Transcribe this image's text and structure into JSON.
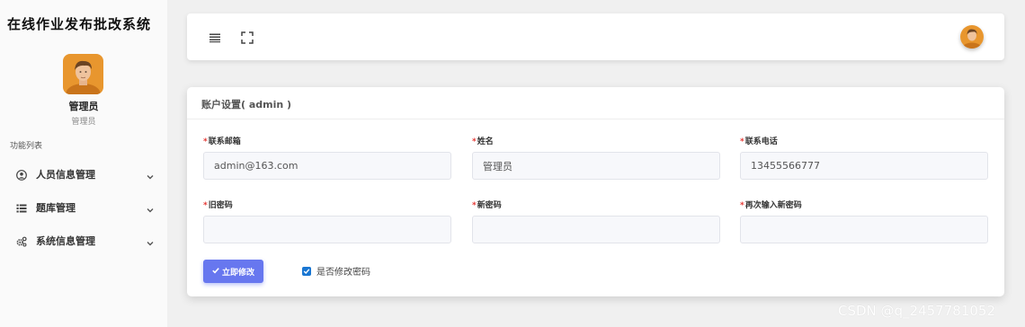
{
  "app": {
    "title": "在线作业发布批改系统"
  },
  "user": {
    "name": "管理员",
    "role": "管理员",
    "avatar_icon": "user-avatar"
  },
  "sidebar": {
    "section_label": "功能列表",
    "items": [
      {
        "label": "人员信息管理",
        "icon": "user-circle-icon"
      },
      {
        "label": "题库管理",
        "icon": "list-icon"
      },
      {
        "label": "系统信息管理",
        "icon": "cogs-icon"
      }
    ]
  },
  "topbar": {
    "menu_icon": "hamburger-icon",
    "fullscreen_icon": "fullscreen-icon"
  },
  "form": {
    "title": "账户设置( admin )",
    "fields": [
      {
        "label": "联系邮箱",
        "value": "admin@163.com",
        "required": true
      },
      {
        "label": "姓名",
        "value": "管理员",
        "required": true
      },
      {
        "label": "联系电话",
        "value": "13455566777",
        "required": true
      },
      {
        "label": "旧密码",
        "value": "",
        "required": true
      },
      {
        "label": "新密码",
        "value": "",
        "required": true
      },
      {
        "label": "再次输入新密码",
        "value": "",
        "required": true
      }
    ],
    "required_mark": "*",
    "submit_label": "立即修改",
    "checkbox_label": "是否修改密码",
    "checkbox_checked": true
  },
  "watermark": "CSDN @q_2457781052",
  "colors": {
    "accent": "#6777ef",
    "required": "#e53935",
    "checkbox": "#1976d2"
  }
}
